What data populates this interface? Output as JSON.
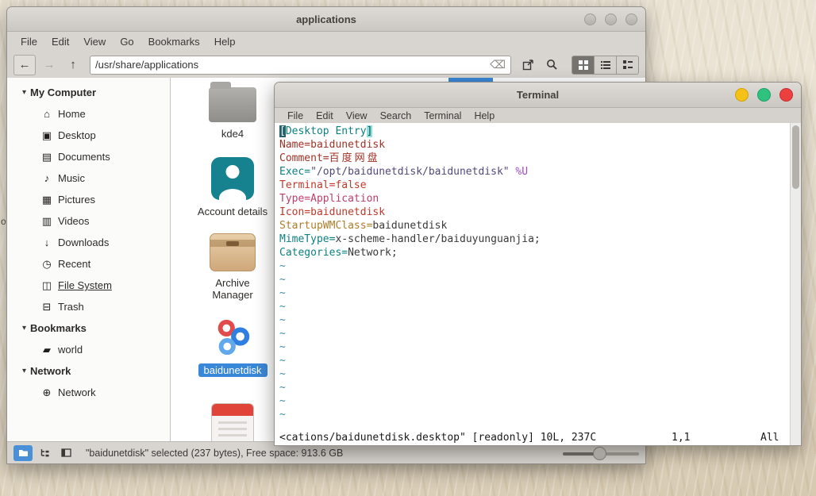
{
  "desktop": {
    "stray_label": "o"
  },
  "file_manager": {
    "title": "applications",
    "menu_items": [
      "File",
      "Edit",
      "View",
      "Go",
      "Bookmarks",
      "Help"
    ],
    "toolbar": {
      "path_value": "/usr/share/applications"
    },
    "sidebar": {
      "sections": [
        {
          "label": "My Computer",
          "items": [
            {
              "icon": "home-icon",
              "glyph": "⌂",
              "label": "Home"
            },
            {
              "icon": "desktop-icon",
              "glyph": "▣",
              "label": "Desktop"
            },
            {
              "icon": "documents-icon",
              "glyph": "▤",
              "label": "Documents"
            },
            {
              "icon": "music-icon",
              "glyph": "♪",
              "label": "Music"
            },
            {
              "icon": "pictures-icon",
              "glyph": "▦",
              "label": "Pictures"
            },
            {
              "icon": "videos-icon",
              "glyph": "▥",
              "label": "Videos"
            },
            {
              "icon": "downloads-icon",
              "glyph": "↓",
              "label": "Downloads"
            },
            {
              "icon": "recent-icon",
              "glyph": "◷",
              "label": "Recent"
            },
            {
              "icon": "filesystem-icon",
              "glyph": "◫",
              "label": "File System",
              "underline": true
            },
            {
              "icon": "trash-icon",
              "glyph": "⊟",
              "label": "Trash"
            }
          ]
        },
        {
          "label": "Bookmarks",
          "items": [
            {
              "icon": "folder-icon",
              "glyph": "▰",
              "label": "world"
            }
          ]
        },
        {
          "label": "Network",
          "items": [
            {
              "icon": "network-icon",
              "glyph": "⊕",
              "label": "Network"
            }
          ]
        }
      ]
    },
    "files": [
      {
        "kind": "folder",
        "label": "kde4",
        "selected": false
      },
      {
        "kind": "account",
        "label": "Account details",
        "selected": false
      },
      {
        "kind": "archive",
        "label": "Archive Manager",
        "selected": false
      },
      {
        "kind": "baidu",
        "label": "baidunetdisk",
        "selected": true
      },
      {
        "kind": "calendar",
        "label": "",
        "selected": false
      }
    ],
    "status_text": "\"baidunetdisk\" selected (237 bytes), Free space: 913.6 GB"
  },
  "terminal": {
    "title": "Terminal",
    "menu_items": [
      "File",
      "Edit",
      "View",
      "Search",
      "Terminal",
      "Help"
    ],
    "buffer_lines": [
      [
        {
          "text": "[",
          "style": "cursor"
        },
        {
          "text": "Desktop Entry",
          "style": "teal"
        },
        {
          "text": "]",
          "style": "match"
        }
      ],
      [
        {
          "text": "Name=baidunetdisk",
          "style": "red"
        }
      ],
      [
        {
          "text": "Comment=",
          "style": "red"
        },
        {
          "text": "百度网盘",
          "style": "red-wide"
        }
      ],
      [
        {
          "text": "Exec=",
          "style": "teal"
        },
        {
          "text": "\"/opt/baidunetdisk/baidunetdisk\"",
          "style": "purple"
        },
        {
          "text": " %U",
          "style": "purple2"
        }
      ],
      [
        {
          "text": "Terminal=false",
          "style": "red2"
        }
      ],
      [
        {
          "text": "Type=Application",
          "style": "pink"
        }
      ],
      [
        {
          "text": "Icon=baidunetdisk",
          "style": "red2"
        }
      ],
      [
        {
          "text": "StartupWMClass=",
          "style": "orange"
        },
        {
          "text": "baidunetdisk",
          "style": "dark"
        }
      ],
      [
        {
          "text": "MimeType=",
          "style": "teal"
        },
        {
          "text": "x-scheme-handler/baiduyunguanjia;",
          "style": "dark"
        }
      ],
      [
        {
          "text": "Categories=",
          "style": "teal"
        },
        {
          "text": "Network;",
          "style": "dark"
        }
      ]
    ],
    "tilde_glyph": "~",
    "tilde_count": 12,
    "status_left": "<cations/baidunetdisk.desktop\" [readonly] 10L, 237C",
    "status_position": "1,1",
    "status_scroll": "All"
  },
  "colors": {
    "selection_blue": "#3987d8",
    "terminal_window_buttons": [
      "#f3c117",
      "#2ec27e",
      "#ec4040"
    ]
  }
}
